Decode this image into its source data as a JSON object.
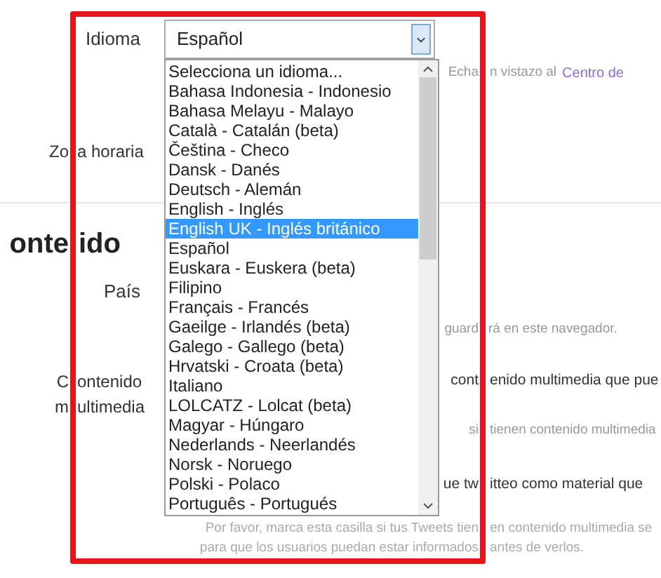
{
  "language": {
    "label": "Idioma",
    "value": "Español",
    "hint": [
      "Echa",
      "n vistazo al"
    ],
    "hint_link": "Centro de"
  },
  "timezone": {
    "label": [
      "Zo",
      "a horaria"
    ]
  },
  "content_section": {
    "heading": [
      "onte",
      "ido"
    ],
    "country": {
      "label": "País",
      "note": [
        "guard",
        "rá en este navegador."
      ]
    },
    "media": {
      "label_line_1": [
        "C",
        "ontenido"
      ],
      "label_line_2": [
        "m",
        "ultimedia"
      ],
      "line_1": [
        "cont",
        "enido multimedia que pue"
      ],
      "note": [
        "si",
        "tienen contenido multimedia"
      ],
      "line_2": [
        "ue tw",
        "itteo como material que"
      ],
      "help_1": [
        "Por favor, marca esta casilla si tus Tweets tien",
        "en contenido multimedia se"
      ],
      "help_2": [
        "para que los usuarios puedan estar informados",
        "antes de verlos."
      ]
    }
  },
  "dropdown": {
    "options": [
      {
        "label": "Selecciona un idioma...",
        "selected": false
      },
      {
        "label": "Bahasa Indonesia - Indonesio",
        "selected": false
      },
      {
        "label": "Bahasa Melayu - Malayo",
        "selected": false
      },
      {
        "label": "Català - Catalán (beta)",
        "selected": false
      },
      {
        "label": "Čeština - Checo",
        "selected": false
      },
      {
        "label": "Dansk - Danés",
        "selected": false
      },
      {
        "label": "Deutsch - Alemán",
        "selected": false
      },
      {
        "label": "English - Inglés",
        "selected": false
      },
      {
        "label": "English UK - Inglés británico",
        "selected": true
      },
      {
        "label": "Español",
        "selected": false
      },
      {
        "label": "Euskara - Euskera (beta)",
        "selected": false
      },
      {
        "label": "Filipino",
        "selected": false
      },
      {
        "label": "Français - Francés",
        "selected": false
      },
      {
        "label": "Gaeilge - Irlandés (beta)",
        "selected": false
      },
      {
        "label": "Galego - Gallego (beta)",
        "selected": false
      },
      {
        "label": "Hrvatski - Croata (beta)",
        "selected": false
      },
      {
        "label": "Italiano",
        "selected": false
      },
      {
        "label": "LOLCATZ - Lolcat (beta)",
        "selected": false
      },
      {
        "label": "Magyar - Húngaro",
        "selected": false
      },
      {
        "label": "Nederlands - Neerlandés",
        "selected": false
      },
      {
        "label": "Norsk - Noruego",
        "selected": false
      },
      {
        "label": "Polski - Polaco",
        "selected": false
      },
      {
        "label": "Português - Portugués",
        "selected": false
      }
    ]
  }
}
